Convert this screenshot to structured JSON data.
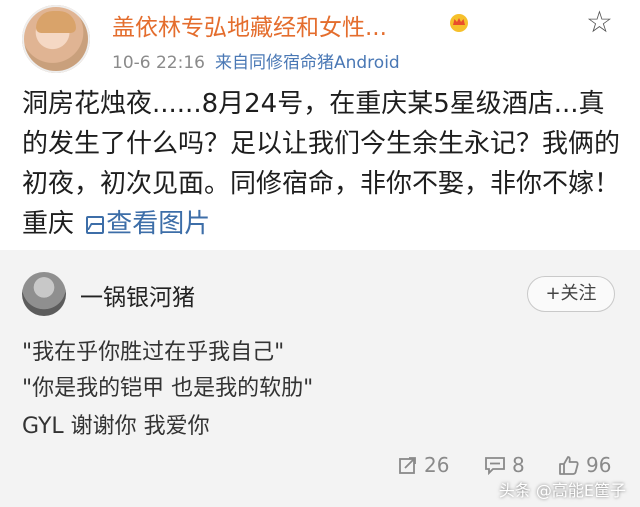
{
  "post": {
    "author": "盖依林专弘地藏经和女性...",
    "timestamp": "10-6 22:16",
    "source": "来自同修宿命猪Android",
    "text": "洞房花烛夜......8月24号，在重庆某5星级酒店...真的发生了什么吗？足以让我们今生余生永记？我俩的初夜，初次见面。同修宿命，非你不娶，非你不嫁！重庆",
    "link_text": "查看图片"
  },
  "comment": {
    "author": "一锅银河猪",
    "follow_label": "+关注",
    "lines": [
      "\"我在乎你胜过在乎我自己\"",
      "\"你是我的铠甲 也是我的软肋\"",
      "GYL 谢谢你 我爱你"
    ],
    "reposts": "26",
    "comments": "8",
    "likes": "96"
  },
  "watermark": "头条 @高能E筐子",
  "colors": {
    "author": "#e46d2d",
    "link": "#3d6ea8",
    "panel": "#f3f3f3"
  }
}
